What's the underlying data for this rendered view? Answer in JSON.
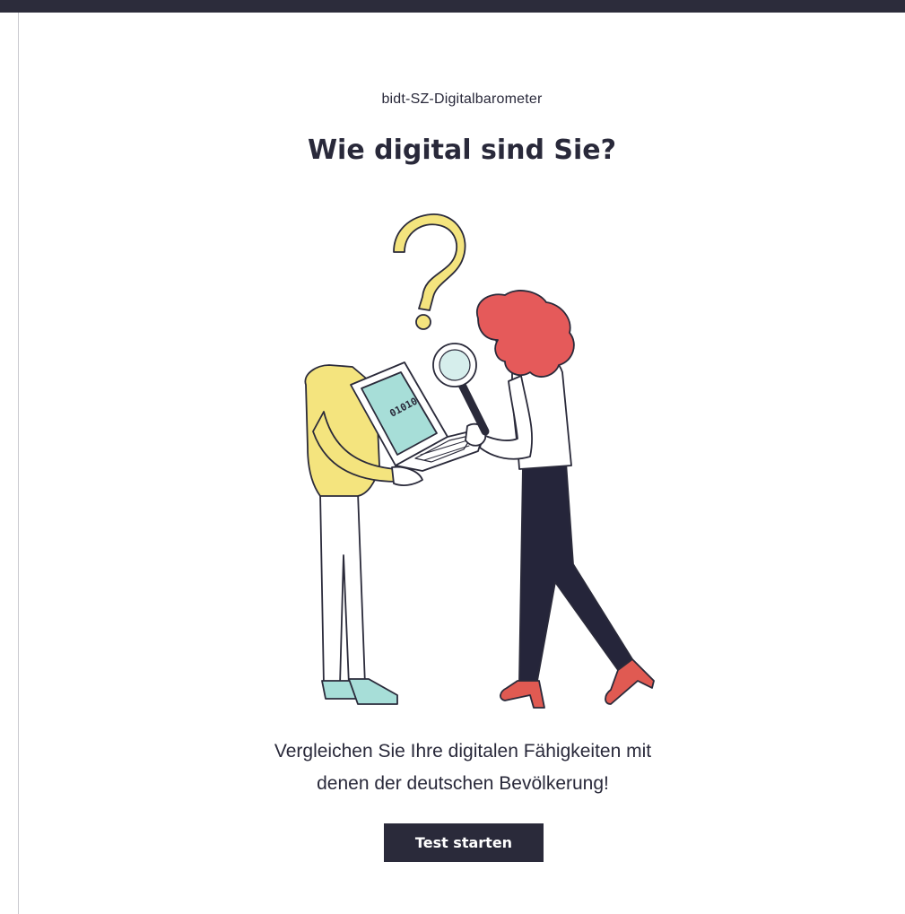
{
  "header": {
    "eyebrow": "bidt-SZ-Digitalbarometer",
    "title": "Wie digital sind Sie?"
  },
  "illustration": {
    "screen_text": "01010",
    "icons": [
      "question-mark-icon",
      "magnifying-glass-icon",
      "laptop-icon"
    ]
  },
  "description": {
    "line1": "Vergleichen Sie Ihre digitalen Fähigkeiten mit",
    "line2": "denen der deutschen Bevölkerung!"
  },
  "cta": {
    "label": "Test starten"
  },
  "colors": {
    "dark": "#2a2a3a",
    "yellow": "#f4e47e",
    "mint": "#a7ded8",
    "red_hair": "#e55a5a",
    "shoes": "#e05a52",
    "pants_dark": "#25253a"
  }
}
